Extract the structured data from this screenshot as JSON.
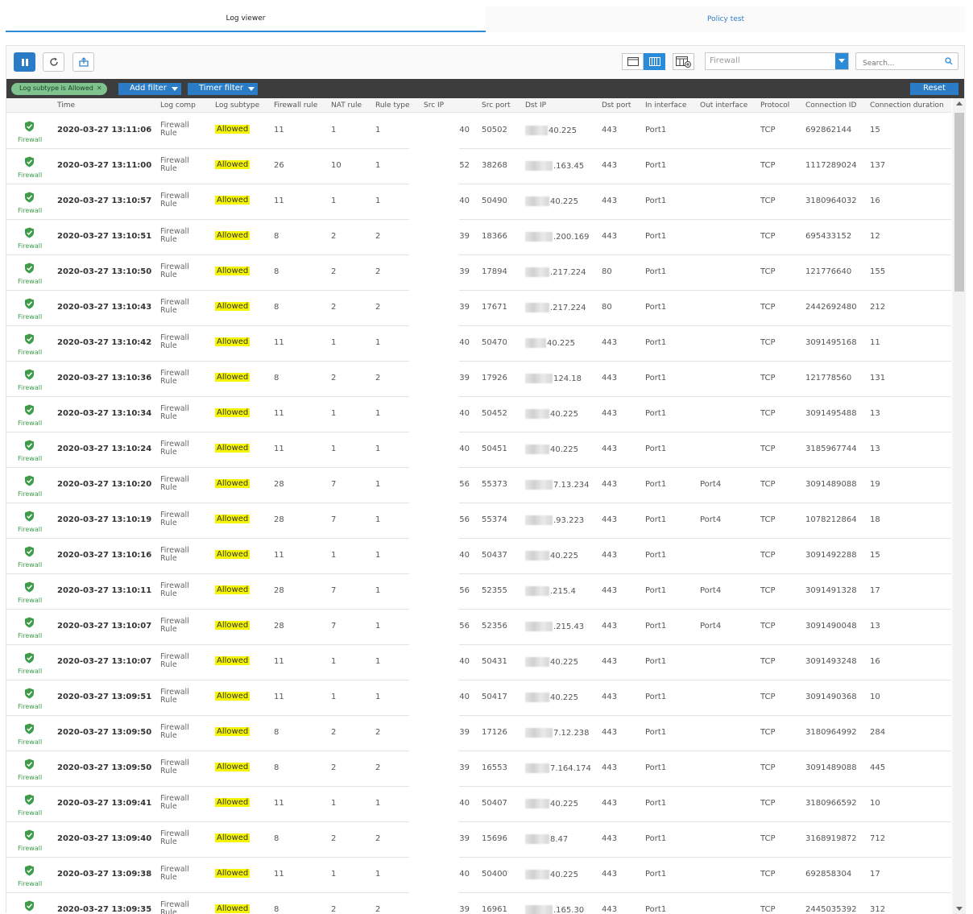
{
  "tabs": [
    {
      "label": "Log viewer",
      "active": true
    },
    {
      "label": "Policy test",
      "active": false
    }
  ],
  "toolbar": {
    "pause_icon": "pause-icon",
    "refresh_icon": "refresh-icon",
    "export_icon": "export-icon",
    "view_icons": [
      "single-pane-view-icon",
      "detailed-view-icon",
      "column-settings-icon"
    ],
    "log_type_select": "Firewall",
    "search_placeholder": "Search..."
  },
  "filters": {
    "active_chip": "Log subtype is Allowed",
    "add_filter": "Add filter",
    "timer_filter": "Timer filter",
    "reset": "Reset"
  },
  "colors": {
    "accent": "#2a7cc7",
    "highlight": "#f5f500",
    "firewall_green": "#3d9b4a"
  },
  "columns": [
    "Time",
    "Log comp",
    "Log subtype",
    "Firewall rule",
    "NAT rule",
    "Rule type",
    "Src IP",
    "Src port",
    "Dst IP",
    "Dst port",
    "In interface",
    "Out interface",
    "Protocol",
    "Connection ID",
    "Connection duration"
  ],
  "rows": [
    {
      "module": "Firewall",
      "time": "2020-03-27 13:11:06",
      "comp1": "Firewall",
      "comp2": "Rule",
      "subtype": "Allowed",
      "fw_rule": "11",
      "nat_rule": "1",
      "rule_type": "1",
      "src_ip": "40",
      "src_port": "50502",
      "dst_ip": "40.225",
      "dst_port": "443",
      "in_if": "Port1",
      "out_if": "",
      "protocol": "TCP",
      "conn_id": "692862144",
      "duration": "15"
    },
    {
      "module": "Firewall",
      "time": "2020-03-27 13:11:00",
      "comp1": "Firewall",
      "comp2": "Rule",
      "subtype": "Allowed",
      "fw_rule": "26",
      "nat_rule": "10",
      "rule_type": "1",
      "src_ip": "52",
      "src_port": "38268",
      "dst_ip": ".163.45",
      "dst_port": "443",
      "in_if": "Port1",
      "out_if": "",
      "protocol": "TCP",
      "conn_id": "1117289024",
      "duration": "137"
    },
    {
      "module": "Firewall",
      "time": "2020-03-27 13:10:57",
      "comp1": "Firewall",
      "comp2": "Rule",
      "subtype": "Allowed",
      "fw_rule": "11",
      "nat_rule": "1",
      "rule_type": "1",
      "src_ip": "40",
      "src_port": "50490",
      "dst_ip": "40.225",
      "dst_port": "443",
      "in_if": "Port1",
      "out_if": "",
      "protocol": "TCP",
      "conn_id": "3180964032",
      "duration": "16"
    },
    {
      "module": "Firewall",
      "time": "2020-03-27 13:10:51",
      "comp1": "Firewall",
      "comp2": "Rule",
      "subtype": "Allowed",
      "fw_rule": "8",
      "nat_rule": "2",
      "rule_type": "2",
      "src_ip": "39",
      "src_port": "18366",
      "dst_ip": ".200.169",
      "dst_port": "443",
      "in_if": "Port1",
      "out_if": "",
      "protocol": "TCP",
      "conn_id": "695433152",
      "duration": "12"
    },
    {
      "module": "Firewall",
      "time": "2020-03-27 13:10:50",
      "comp1": "Firewall",
      "comp2": "Rule",
      "subtype": "Allowed",
      "fw_rule": "8",
      "nat_rule": "2",
      "rule_type": "2",
      "src_ip": "39",
      "src_port": "17894",
      "dst_ip": ".217.224",
      "dst_port": "80",
      "in_if": "Port1",
      "out_if": "",
      "protocol": "TCP",
      "conn_id": "121776640",
      "duration": "155"
    },
    {
      "module": "Firewall",
      "time": "2020-03-27 13:10:43",
      "comp1": "Firewall",
      "comp2": "Rule",
      "subtype": "Allowed",
      "fw_rule": "8",
      "nat_rule": "2",
      "rule_type": "2",
      "src_ip": "39",
      "src_port": "17671",
      "dst_ip": ".217.224",
      "dst_port": "80",
      "in_if": "Port1",
      "out_if": "",
      "protocol": "TCP",
      "conn_id": "2442692480",
      "duration": "212"
    },
    {
      "module": "Firewall",
      "time": "2020-03-27 13:10:42",
      "comp1": "Firewall",
      "comp2": "Rule",
      "subtype": "Allowed",
      "fw_rule": "11",
      "nat_rule": "1",
      "rule_type": "1",
      "src_ip": "40",
      "src_port": "50470",
      "dst_ip": "40.225",
      "dst_port": "443",
      "in_if": "Port1",
      "out_if": "",
      "protocol": "TCP",
      "conn_id": "3091495168",
      "duration": "11"
    },
    {
      "module": "Firewall",
      "time": "2020-03-27 13:10:36",
      "comp1": "Firewall",
      "comp2": "Rule",
      "subtype": "Allowed",
      "fw_rule": "8",
      "nat_rule": "2",
      "rule_type": "2",
      "src_ip": "39",
      "src_port": "17926",
      "dst_ip": "124.18",
      "dst_port": "443",
      "in_if": "Port1",
      "out_if": "",
      "protocol": "TCP",
      "conn_id": "121778560",
      "duration": "131"
    },
    {
      "module": "Firewall",
      "time": "2020-03-27 13:10:34",
      "comp1": "Firewall",
      "comp2": "Rule",
      "subtype": "Allowed",
      "fw_rule": "11",
      "nat_rule": "1",
      "rule_type": "1",
      "src_ip": "40",
      "src_port": "50452",
      "dst_ip": "40.225",
      "dst_port": "443",
      "in_if": "Port1",
      "out_if": "",
      "protocol": "TCP",
      "conn_id": "3091495488",
      "duration": "13"
    },
    {
      "module": "Firewall",
      "time": "2020-03-27 13:10:24",
      "comp1": "Firewall",
      "comp2": "Rule",
      "subtype": "Allowed",
      "fw_rule": "11",
      "nat_rule": "1",
      "rule_type": "1",
      "src_ip": "40",
      "src_port": "50451",
      "dst_ip": "40.225",
      "dst_port": "443",
      "in_if": "Port1",
      "out_if": "",
      "protocol": "TCP",
      "conn_id": "3185967744",
      "duration": "13"
    },
    {
      "module": "Firewall",
      "time": "2020-03-27 13:10:20",
      "comp1": "Firewall",
      "comp2": "Rule",
      "subtype": "Allowed",
      "fw_rule": "28",
      "nat_rule": "7",
      "rule_type": "1",
      "src_ip": "56",
      "src_port": "55373",
      "dst_ip": "7.13.234",
      "dst_port": "443",
      "in_if": "Port1",
      "out_if": "Port4",
      "protocol": "TCP",
      "conn_id": "3091489088",
      "duration": "19"
    },
    {
      "module": "Firewall",
      "time": "2020-03-27 13:10:19",
      "comp1": "Firewall",
      "comp2": "Rule",
      "subtype": "Allowed",
      "fw_rule": "28",
      "nat_rule": "7",
      "rule_type": "1",
      "src_ip": "56",
      "src_port": "55374",
      "dst_ip": ".93.223",
      "dst_port": "443",
      "in_if": "Port1",
      "out_if": "Port4",
      "protocol": "TCP",
      "conn_id": "1078212864",
      "duration": "18"
    },
    {
      "module": "Firewall",
      "time": "2020-03-27 13:10:16",
      "comp1": "Firewall",
      "comp2": "Rule",
      "subtype": "Allowed",
      "fw_rule": "11",
      "nat_rule": "1",
      "rule_type": "1",
      "src_ip": "40",
      "src_port": "50437",
      "dst_ip": "40.225",
      "dst_port": "443",
      "in_if": "Port1",
      "out_if": "",
      "protocol": "TCP",
      "conn_id": "3091492288",
      "duration": "15"
    },
    {
      "module": "Firewall",
      "time": "2020-03-27 13:10:11",
      "comp1": "Firewall",
      "comp2": "Rule",
      "subtype": "Allowed",
      "fw_rule": "28",
      "nat_rule": "7",
      "rule_type": "1",
      "src_ip": "56",
      "src_port": "52355",
      "dst_ip": ".215.4",
      "dst_port": "443",
      "in_if": "Port1",
      "out_if": "Port4",
      "protocol": "TCP",
      "conn_id": "3091491328",
      "duration": "17"
    },
    {
      "module": "Firewall",
      "time": "2020-03-27 13:10:07",
      "comp1": "Firewall",
      "comp2": "Rule",
      "subtype": "Allowed",
      "fw_rule": "28",
      "nat_rule": "7",
      "rule_type": "1",
      "src_ip": "56",
      "src_port": "52356",
      "dst_ip": ".215.43",
      "dst_port": "443",
      "in_if": "Port1",
      "out_if": "Port4",
      "protocol": "TCP",
      "conn_id": "3091490048",
      "duration": "13"
    },
    {
      "module": "Firewall",
      "time": "2020-03-27 13:10:07",
      "comp1": "Firewall",
      "comp2": "Rule",
      "subtype": "Allowed",
      "fw_rule": "11",
      "nat_rule": "1",
      "rule_type": "1",
      "src_ip": "40",
      "src_port": "50431",
      "dst_ip": "40.225",
      "dst_port": "443",
      "in_if": "Port1",
      "out_if": "",
      "protocol": "TCP",
      "conn_id": "3091493248",
      "duration": "16"
    },
    {
      "module": "Firewall",
      "time": "2020-03-27 13:09:51",
      "comp1": "Firewall",
      "comp2": "Rule",
      "subtype": "Allowed",
      "fw_rule": "11",
      "nat_rule": "1",
      "rule_type": "1",
      "src_ip": "40",
      "src_port": "50417",
      "dst_ip": "40.225",
      "dst_port": "443",
      "in_if": "Port1",
      "out_if": "",
      "protocol": "TCP",
      "conn_id": "3091490368",
      "duration": "10"
    },
    {
      "module": "Firewall",
      "time": "2020-03-27 13:09:50",
      "comp1": "Firewall",
      "comp2": "Rule",
      "subtype": "Allowed",
      "fw_rule": "8",
      "nat_rule": "2",
      "rule_type": "2",
      "src_ip": "39",
      "src_port": "17126",
      "dst_ip": "7.12.238",
      "dst_port": "443",
      "in_if": "Port1",
      "out_if": "",
      "protocol": "TCP",
      "conn_id": "3180964992",
      "duration": "284"
    },
    {
      "module": "Firewall",
      "time": "2020-03-27 13:09:50",
      "comp1": "Firewall",
      "comp2": "Rule",
      "subtype": "Allowed",
      "fw_rule": "8",
      "nat_rule": "2",
      "rule_type": "2",
      "src_ip": "39",
      "src_port": "16553",
      "dst_ip": "7.164.174",
      "dst_port": "443",
      "in_if": "Port1",
      "out_if": "",
      "protocol": "TCP",
      "conn_id": "3091489088",
      "duration": "445"
    },
    {
      "module": "Firewall",
      "time": "2020-03-27 13:09:41",
      "comp1": "Firewall",
      "comp2": "Rule",
      "subtype": "Allowed",
      "fw_rule": "11",
      "nat_rule": "1",
      "rule_type": "1",
      "src_ip": "40",
      "src_port": "50407",
      "dst_ip": "40.225",
      "dst_port": "443",
      "in_if": "Port1",
      "out_if": "",
      "protocol": "TCP",
      "conn_id": "3180966592",
      "duration": "10"
    },
    {
      "module": "Firewall",
      "time": "2020-03-27 13:09:40",
      "comp1": "Firewall",
      "comp2": "Rule",
      "subtype": "Allowed",
      "fw_rule": "8",
      "nat_rule": "2",
      "rule_type": "2",
      "src_ip": "39",
      "src_port": "15696",
      "dst_ip": "8.47",
      "dst_port": "443",
      "in_if": "Port1",
      "out_if": "",
      "protocol": "TCP",
      "conn_id": "3168919872",
      "duration": "712"
    },
    {
      "module": "Firewall",
      "time": "2020-03-27 13:09:38",
      "comp1": "Firewall",
      "comp2": "Rule",
      "subtype": "Allowed",
      "fw_rule": "11",
      "nat_rule": "1",
      "rule_type": "1",
      "src_ip": "40",
      "src_port": "50400",
      "dst_ip": "40.225",
      "dst_port": "443",
      "in_if": "Port1",
      "out_if": "",
      "protocol": "TCP",
      "conn_id": "692858304",
      "duration": "17"
    },
    {
      "module": "Firewall",
      "time": "2020-03-27 13:09:35",
      "comp1": "Firewall",
      "comp2": "Rule",
      "subtype": "Allowed",
      "fw_rule": "8",
      "nat_rule": "2",
      "rule_type": "2",
      "src_ip": "39",
      "src_port": "16961",
      "dst_ip": ".165.30",
      "dst_port": "443",
      "in_if": "Port1",
      "out_if": "",
      "protocol": "TCP",
      "conn_id": "2445035392",
      "duration": "312"
    }
  ]
}
